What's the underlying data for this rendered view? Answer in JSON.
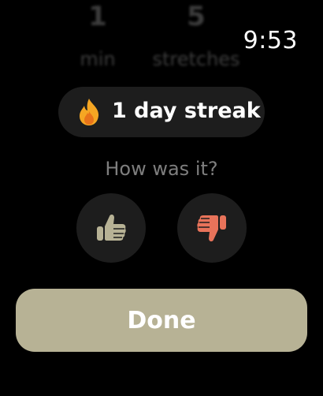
{
  "summary": {
    "minutes": {
      "value": "1",
      "unit": "min"
    },
    "stretches": {
      "value": "5",
      "unit": "stretches"
    }
  },
  "status": {
    "time": "9:53"
  },
  "streak": {
    "icon": "flame-icon",
    "label": "1 day streak"
  },
  "feedback": {
    "question": "How was it?",
    "like_icon": "thumbs-up-icon",
    "dislike_icon": "thumbs-down-icon"
  },
  "actions": {
    "done_label": "Done"
  },
  "colors": {
    "background": "#000000",
    "pill": "#1d1d1d",
    "done_button": "#b7b295",
    "thumb_up": "#b7b295",
    "thumb_down": "#e8735a",
    "flame_outer": "#f5a623",
    "flame_inner": "#e8731a",
    "muted_text": "#7e7e7e"
  }
}
